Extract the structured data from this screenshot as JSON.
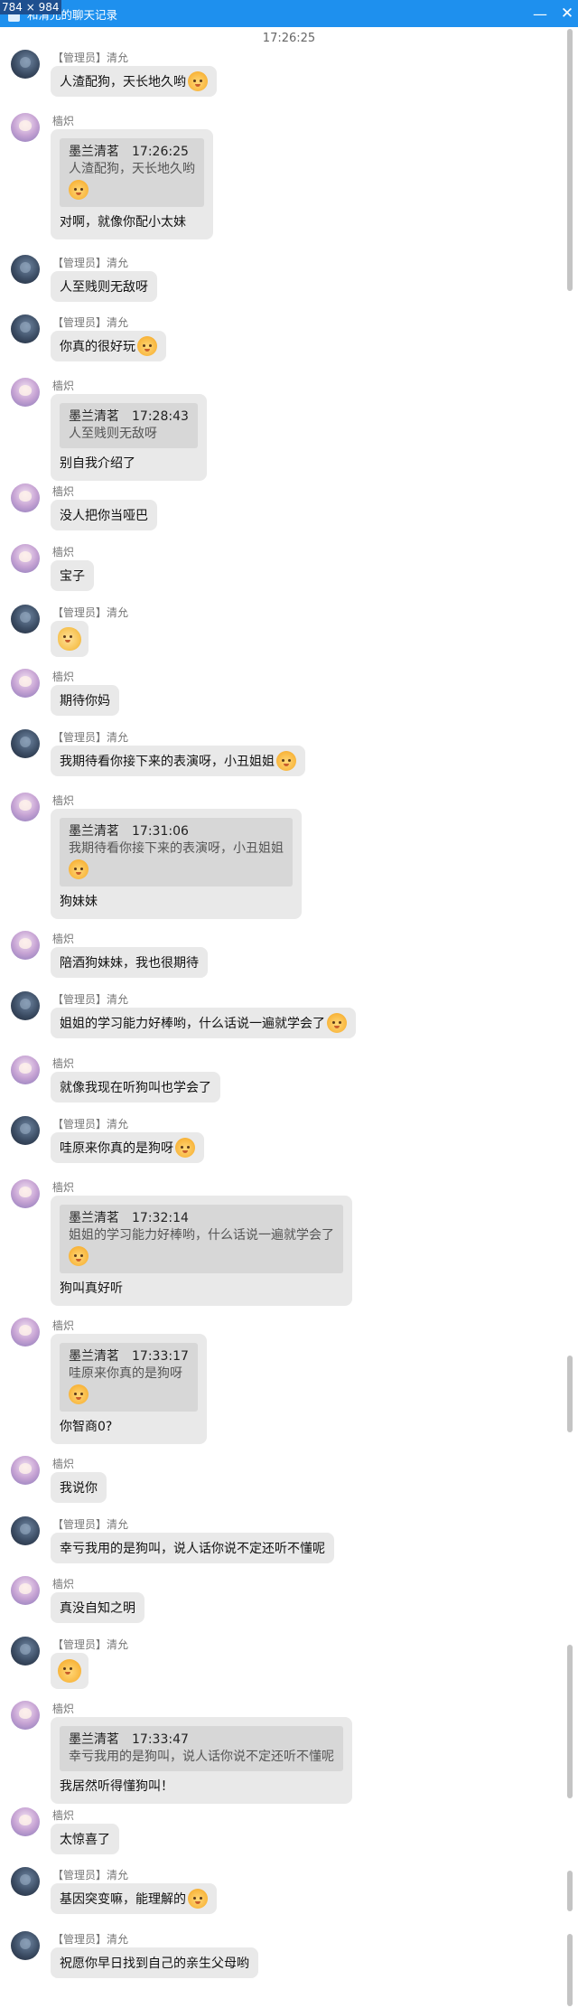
{
  "window": {
    "dimension_overlay": "784 × 984",
    "title": "和清允的聊天记录",
    "minimize": "—",
    "close": "✕"
  },
  "timestamp": "17:26:25",
  "names": {
    "admin_role": "【管理员】",
    "admin": "清允",
    "user": "樯炽"
  },
  "messages": [
    {
      "text": "人渣配狗，天长地久哟"
    },
    {
      "quote_name": "墨兰清茗",
      "quote_time": "17:26:25",
      "quote_text": "人渣配狗，天长地久哟",
      "reply": "对啊，就像你配小太妹"
    },
    {
      "text": "人至贱则无敌呀"
    },
    {
      "text": "你真的很好玩"
    },
    {
      "quote_name": "墨兰清茗",
      "quote_time": "17:28:43",
      "quote_text": "人至贱则无敌呀",
      "reply": "别自我介绍了"
    },
    {
      "text": "没人把你当哑巴"
    },
    {
      "text": "宝子"
    },
    {
      "text": ""
    },
    {
      "text": "期待你妈"
    },
    {
      "text": "我期待看你接下来的表演呀，小丑姐姐"
    },
    {
      "quote_name": "墨兰清茗",
      "quote_time": "17:31:06",
      "quote_text": "我期待看你接下来的表演呀，小丑姐姐",
      "reply": "狗妹妹"
    },
    {
      "text": "陪酒狗妹妹，我也很期待"
    },
    {
      "text": "姐姐的学习能力好棒哟，什么话说一遍就学会了"
    },
    {
      "text": "就像我现在听狗叫也学会了"
    },
    {
      "text": "哇原来你真的是狗呀"
    },
    {
      "quote_name": "墨兰清茗",
      "quote_time": "17:32:14",
      "quote_text": "姐姐的学习能力好棒哟，什么话说一遍就学会了",
      "reply": "狗叫真好听"
    },
    {
      "quote_name": "墨兰清茗",
      "quote_time": "17:33:17",
      "quote_text": "哇原来你真的是狗呀",
      "reply": "你智商0?"
    },
    {
      "text": "我说你"
    },
    {
      "text": "幸亏我用的是狗叫，说人话你说不定还听不懂呢"
    },
    {
      "text": "真没自知之明"
    },
    {
      "text": ""
    },
    {
      "quote_name": "墨兰清茗",
      "quote_time": "17:33:47",
      "quote_text": "幸亏我用的是狗叫，说人话你说不定还听不懂呢",
      "reply": "我居然听得懂狗叫！"
    },
    {
      "text": "太惊喜了"
    },
    {
      "text": "基因突变嘛，能理解的"
    },
    {
      "text": "祝愿你早日找到自己的亲生父母哟"
    }
  ],
  "icons": {
    "emoji": "dog-face-emoji",
    "emoji_hand": "hand-emoji"
  }
}
